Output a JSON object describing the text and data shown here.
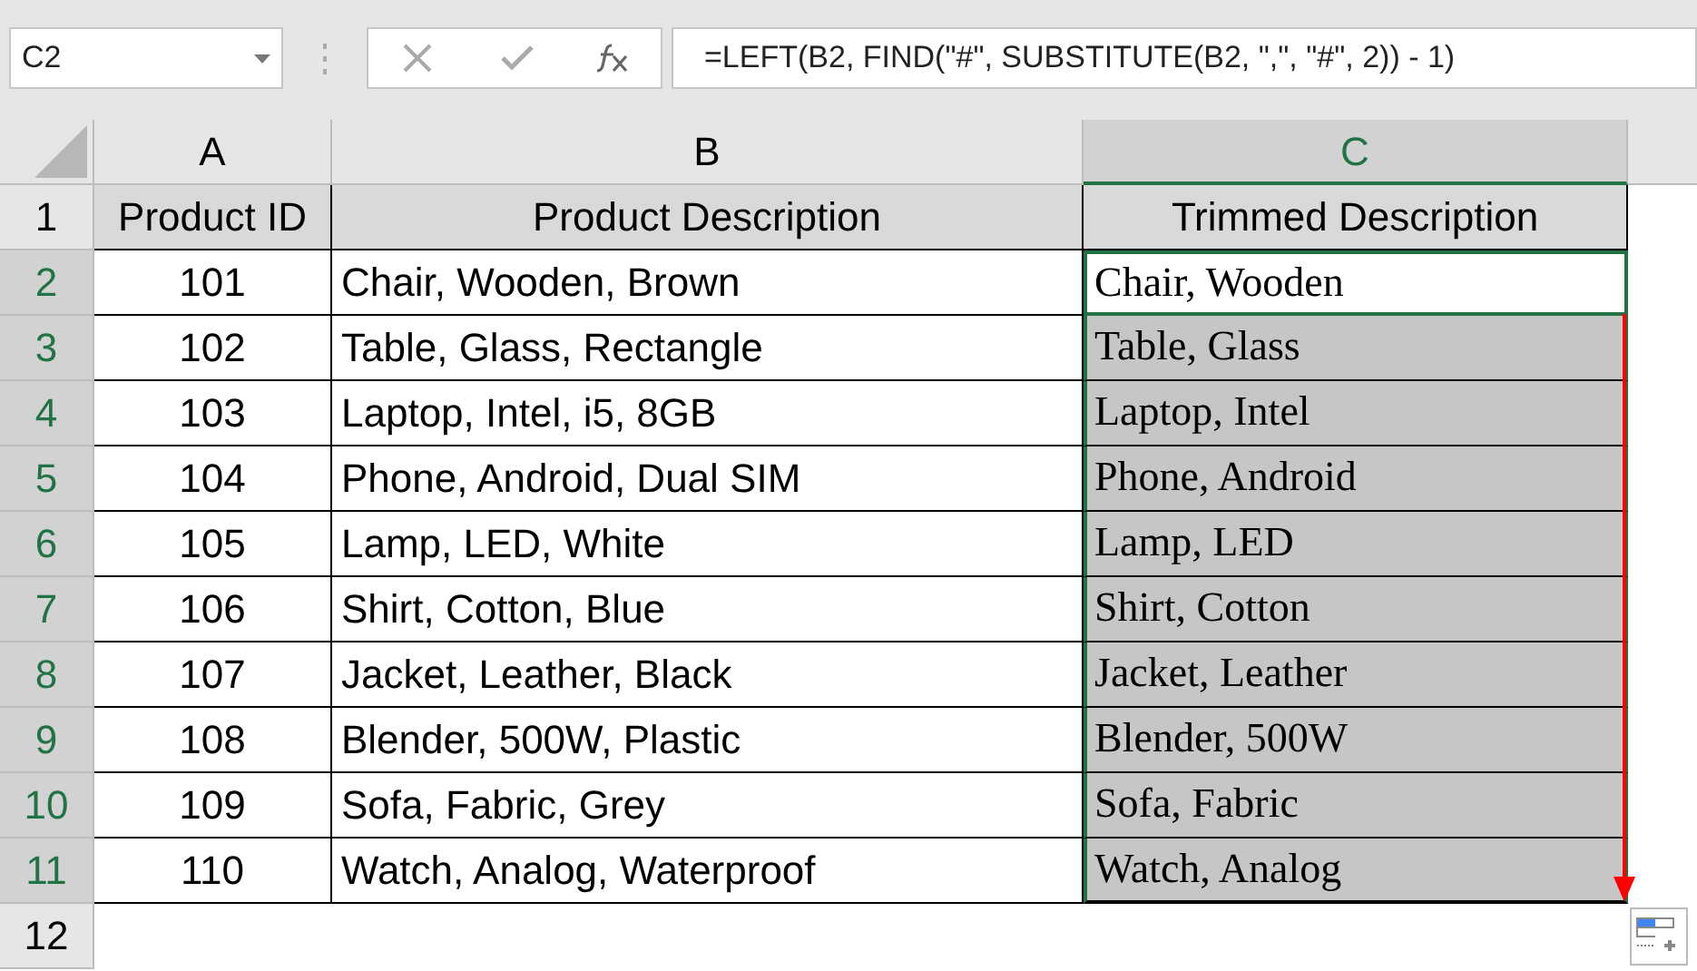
{
  "name_box": "C2",
  "formula": "=LEFT(B2, FIND(\"#\", SUBSTITUTE(B2, \",\", \"#\", 2)) - 1)",
  "columns": [
    {
      "label": "A",
      "selected": false
    },
    {
      "label": "B",
      "selected": false
    },
    {
      "label": "C",
      "selected": true
    }
  ],
  "rows": [
    {
      "number": "1",
      "selected": false,
      "cells": [
        "Product ID",
        "Product Description",
        "Trimmed Description"
      ]
    },
    {
      "number": "2",
      "selected": true,
      "cells": [
        "101",
        "Chair, Wooden, Brown",
        "Chair, Wooden"
      ]
    },
    {
      "number": "3",
      "selected": true,
      "cells": [
        "102",
        "Table, Glass, Rectangle",
        "Table, Glass"
      ]
    },
    {
      "number": "4",
      "selected": true,
      "cells": [
        "103",
        "Laptop, Intel, i5, 8GB",
        "Laptop, Intel"
      ]
    },
    {
      "number": "5",
      "selected": true,
      "cells": [
        "104",
        "Phone, Android, Dual SIM",
        "Phone, Android"
      ]
    },
    {
      "number": "6",
      "selected": true,
      "cells": [
        "105",
        "Lamp, LED, White",
        "Lamp, LED"
      ]
    },
    {
      "number": "7",
      "selected": true,
      "cells": [
        "106",
        "Shirt, Cotton, Blue",
        "Shirt, Cotton"
      ]
    },
    {
      "number": "8",
      "selected": true,
      "cells": [
        "107",
        "Jacket, Leather, Black",
        "Jacket, Leather"
      ]
    },
    {
      "number": "9",
      "selected": true,
      "cells": [
        "108",
        "Blender, 500W, Plastic",
        "Blender, 500W"
      ]
    },
    {
      "number": "10",
      "selected": true,
      "cells": [
        "109",
        "Sofa, Fabric, Grey",
        "Sofa, Fabric"
      ]
    },
    {
      "number": "11",
      "selected": true,
      "cells": [
        "110",
        "Watch, Analog, Waterproof",
        "Watch, Analog"
      ]
    },
    {
      "number": "12",
      "selected": false
    }
  ]
}
